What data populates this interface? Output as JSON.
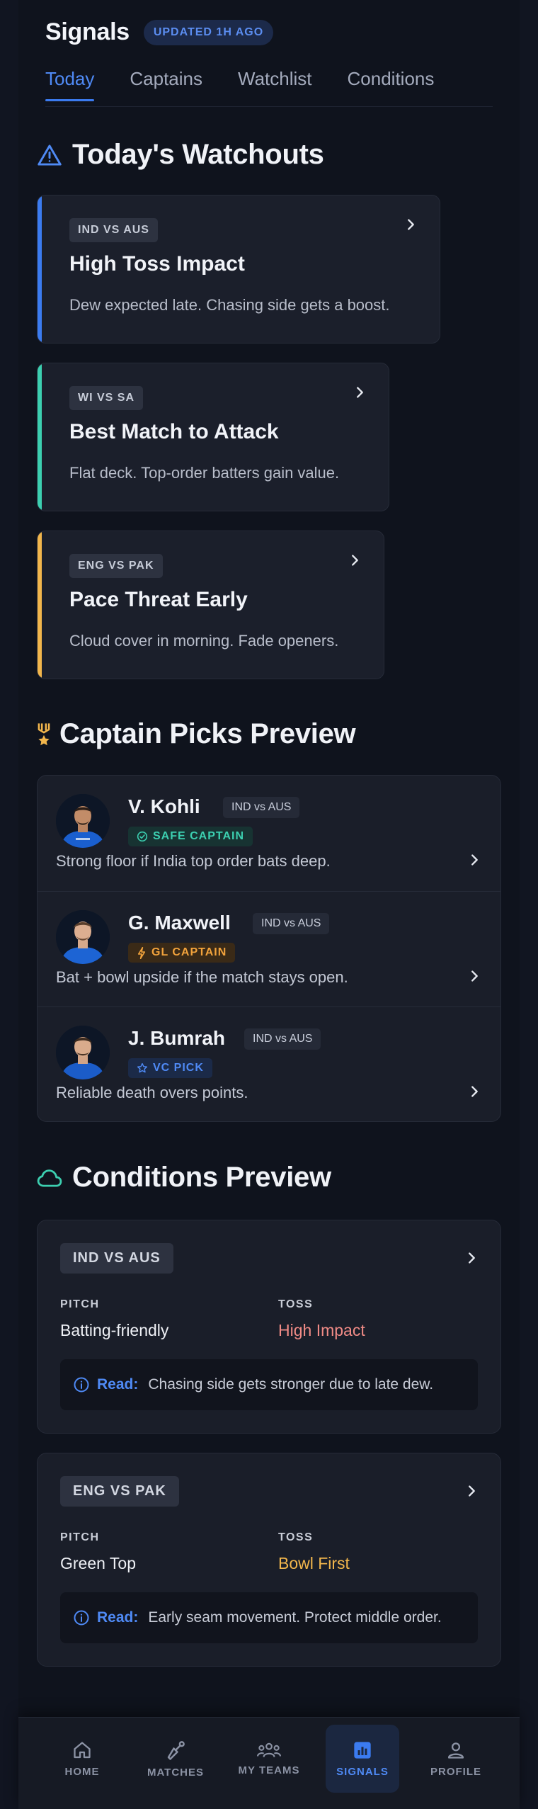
{
  "header": {
    "title": "Signals",
    "updated": "UPDATED 1H AGO"
  },
  "tabs": [
    {
      "label": "Today",
      "active": true
    },
    {
      "label": "Captains",
      "active": false
    },
    {
      "label": "Watchlist",
      "active": false
    },
    {
      "label": "Conditions",
      "active": false
    }
  ],
  "watchouts": {
    "title": "Today's Watchouts",
    "cards": [
      {
        "tag": "IND VS AUS",
        "title": "High Toss Impact",
        "desc": "Dew expected late. Chasing side gets a boost.",
        "accent": "#3b7bf0"
      },
      {
        "tag": "WI VS SA",
        "title": "Best Match to Attack",
        "desc": "Flat deck. Top-order batters gain value.",
        "accent": "#3ccfb0"
      },
      {
        "tag": "ENG VS PAK",
        "title": "Pace Threat Early",
        "desc": "Cloud cover in morning. Fade openers.",
        "accent": "#f2b64c"
      }
    ]
  },
  "captains": {
    "title": "Captain Picks Preview",
    "rows": [
      {
        "name": "V. Kohli",
        "match": "IND vs AUS",
        "badge": "SAFE CAPTAIN",
        "badge_color": "#3ccfb0",
        "badge_bg": "#173332",
        "note": "Strong floor if India top order bats deep."
      },
      {
        "name": "G. Maxwell",
        "match": "IND vs AUS",
        "badge": "GL CAPTAIN",
        "badge_color": "#f2a33c",
        "badge_bg": "#3a2a17",
        "note": "Bat + bowl upside if the match stays open."
      },
      {
        "name": "J. Bumrah",
        "match": "IND vs AUS",
        "badge": "VC PICK",
        "badge_color": "#4f8af5",
        "badge_bg": "#1b2a48",
        "note": "Reliable death overs points."
      }
    ]
  },
  "conditions": {
    "title": "Conditions Preview",
    "pitch_label": "PITCH",
    "toss_label": "TOSS",
    "read_label": "Read:",
    "cards": [
      {
        "tag": "IND VS AUS",
        "pitch": "Batting-friendly",
        "toss": "High Impact",
        "toss_color": "#f08b86",
        "read": "Chasing side gets stronger due to late dew."
      },
      {
        "tag": "ENG VS PAK",
        "pitch": "Green Top",
        "toss": "Bowl First",
        "toss_color": "#f2b64c",
        "read": "Early seam movement. Protect middle order."
      }
    ]
  },
  "nav": [
    {
      "label": "HOME",
      "icon": "home-icon",
      "active": false
    },
    {
      "label": "MATCHES",
      "icon": "cricket-bat-icon",
      "active": false
    },
    {
      "label": "MY TEAMS",
      "icon": "team-icon",
      "active": false
    },
    {
      "label": "SIGNALS",
      "icon": "signals-icon",
      "active": true
    },
    {
      "label": "PROFILE",
      "icon": "profile-icon",
      "active": false
    }
  ],
  "colors": {
    "accent": "#3b7bf0",
    "background": "#0f131d",
    "card": "#1b1f2b"
  }
}
